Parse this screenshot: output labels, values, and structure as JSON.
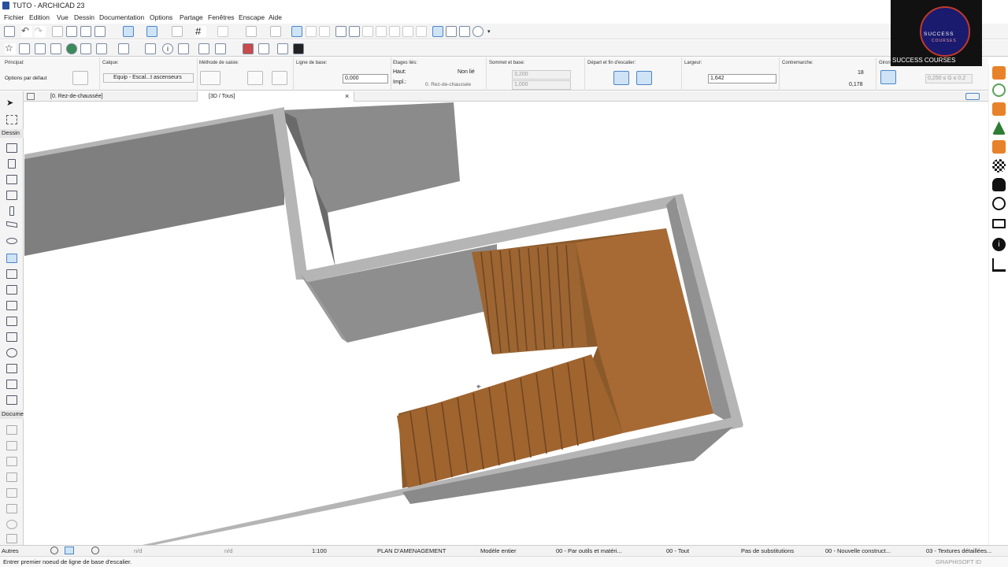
{
  "window": {
    "title": "TUTO - ARCHICAD 23"
  },
  "menu": [
    "Fichier",
    "Edition",
    "Vue",
    "Dessin",
    "Documentation",
    "Options",
    "Partage",
    "Fenêtres",
    "Enscape",
    "Aide"
  ],
  "logo": {
    "line1": "SUCCESS",
    "line2": "COURSES",
    "caption": "SUCCESS COURSES",
    "accent": "#1a1a6e"
  },
  "infobox": {
    "principal_label": "Principal:",
    "principal_value": "Options par défaut",
    "calque_label": "Calque:",
    "calque_value": "Equip - Escal...t ascenseurs",
    "methode_label": "Méthode de saisie:",
    "ligne_label": "Ligne de base:",
    "ligne_value": "0,000",
    "etages_label": "Etages liés:",
    "haut_label": "Haut:",
    "haut_value": "Non lié",
    "impl_label": "Impl.:",
    "impl_value": "0. Rez-de-chaussée",
    "sommet_label": "Sommet et base:",
    "sommet_value": "3,200",
    "base_value": "1,000",
    "depart_label": "Départ et fin d'escalier:",
    "largeur_label": "Largeur:",
    "largeur_value": "1,642",
    "contremarche_label": "Contremarche:",
    "contremarche_count": "18",
    "contremarche_height": "0,178",
    "giron_label": "Giron",
    "giron_value": "0,250 ≤ G ≤ 0,2"
  },
  "tabs": [
    {
      "label": "[0. Rez-de-chaussée]"
    },
    {
      "label": "[3D / Tous]"
    }
  ],
  "toolbox": {
    "dessin": "Dessin",
    "document": "Docume",
    "autres": "Autres"
  },
  "status": {
    "nd1": "n/d",
    "nd2": "n/d",
    "scale": "1:100",
    "plan": "PLAN D'AMENAGEMENT",
    "modele": "Modèle entier",
    "outils": "00 - Par outils et matéri...",
    "tout": "00 - Tout",
    "substitutions": "Pas de substitutions",
    "construct": "00 - Nouvelle construct...",
    "textures": "03 - Textures détaillées..."
  },
  "hint": "Entrer premier noeud de ligne de base d'escalier.",
  "graphisoft": "GRAPHISOFT ID",
  "colors": {
    "wall_top": "#b5b5b5",
    "wall_side": "#8a8a8a",
    "wood": "#a86a35",
    "select": "#cfe3f6"
  }
}
